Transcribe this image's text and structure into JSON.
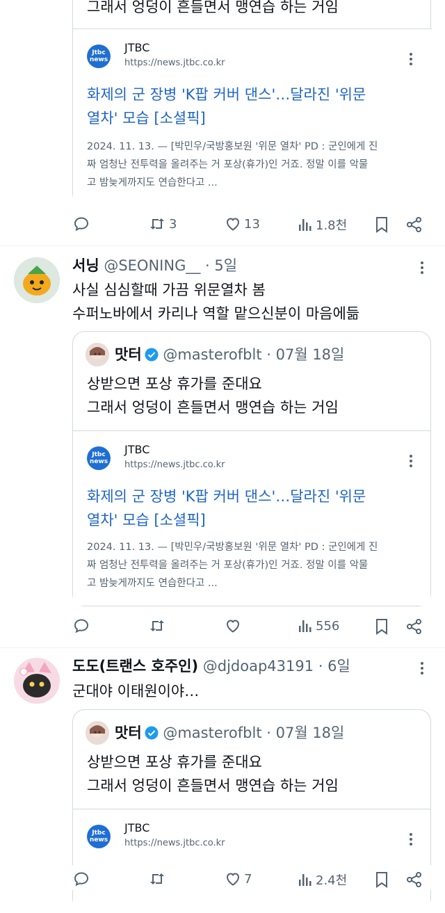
{
  "top_tweet": {
    "quote_line2": "그래서 엉덩이 흔들면서 맹연습 하는 거임",
    "link": {
      "source": "JTBC",
      "url": "https://news.jtbc.co.kr",
      "logo_text": "Jtbc news",
      "headline_line1": "화제의 군 장병 'K팝 커버 댄스'…달라진 '위문",
      "headline_line2": "열차' 모습 [소셜픽]",
      "desc_line1": "2024. 11. 13. — [박민우/국방홍보원 '위문 열차' PD : 군인에게 진",
      "desc_line2": "짜 엄청난 전투력을 올려주는 거 포상(휴가)인 거죠. 정말 이를 악물",
      "desc_line3": "고 밤늦게까지도 연습한다고 ..."
    },
    "actions": {
      "reply": "",
      "retweet": "3",
      "like": "13",
      "views": "1.8천"
    }
  },
  "tweet2": {
    "name": "서닝",
    "handle": "@SEONING__",
    "time": "· 5일",
    "text_line1": "사실 심심할때 가끔 위문열차 봄",
    "text_line2": "수퍼노바에서 카리나 역할 맡으신분이 마음에듦",
    "quote": {
      "name": "맛터",
      "handle": "@masterofblt",
      "date": "· 07월 18일",
      "line1": "상받으면 포상 휴가를 준대요",
      "line2": "그래서 엉덩이 흔들면서 맹연습 하는 거임",
      "link": {
        "source": "JTBC",
        "url": "https://news.jtbc.co.kr",
        "logo_text": "Jtbc news",
        "headline_line1": "화제의 군 장병 'K팝 커버 댄스'…달라진 '위문",
        "headline_line2": "열차' 모습 [소셜픽]",
        "desc_line1": "2024. 11. 13. — [박민우/국방홍보원 '위문 열차' PD : 군인에게 진",
        "desc_line2": "짜 엄청난 전투력을 올려주는 거 포상(휴가)인 거죠. 정말 이를 악물",
        "desc_line3": "고 밤늦게까지도 연습한다고 ..."
      }
    },
    "actions": {
      "reply": "",
      "retweet": "",
      "like": "",
      "views": "556"
    }
  },
  "tweet3": {
    "name": "도도(트랜스 호주인)",
    "handle": "@djdoap43191",
    "time": "· 6일",
    "text_line1": "군대야 이태원이야…",
    "quote": {
      "name": "맛터",
      "handle": "@masterofblt",
      "date": "· 07월 18일",
      "line1": "상받으면 포상 휴가를 준대요",
      "line2": "그래서 엉덩이 흔들면서 맹연습 하는 거임",
      "link": {
        "source": "JTBC",
        "url": "https://news.jtbc.co.kr",
        "logo_text": "Jtbc news"
      }
    },
    "actions": {
      "reply": "",
      "retweet": "",
      "like": "7",
      "views": "2.4천"
    }
  },
  "colors": {
    "link_blue": "#1d64c7",
    "verified_blue": "#1d9bf0",
    "muted": "#536471",
    "border": "#cfd9de"
  }
}
